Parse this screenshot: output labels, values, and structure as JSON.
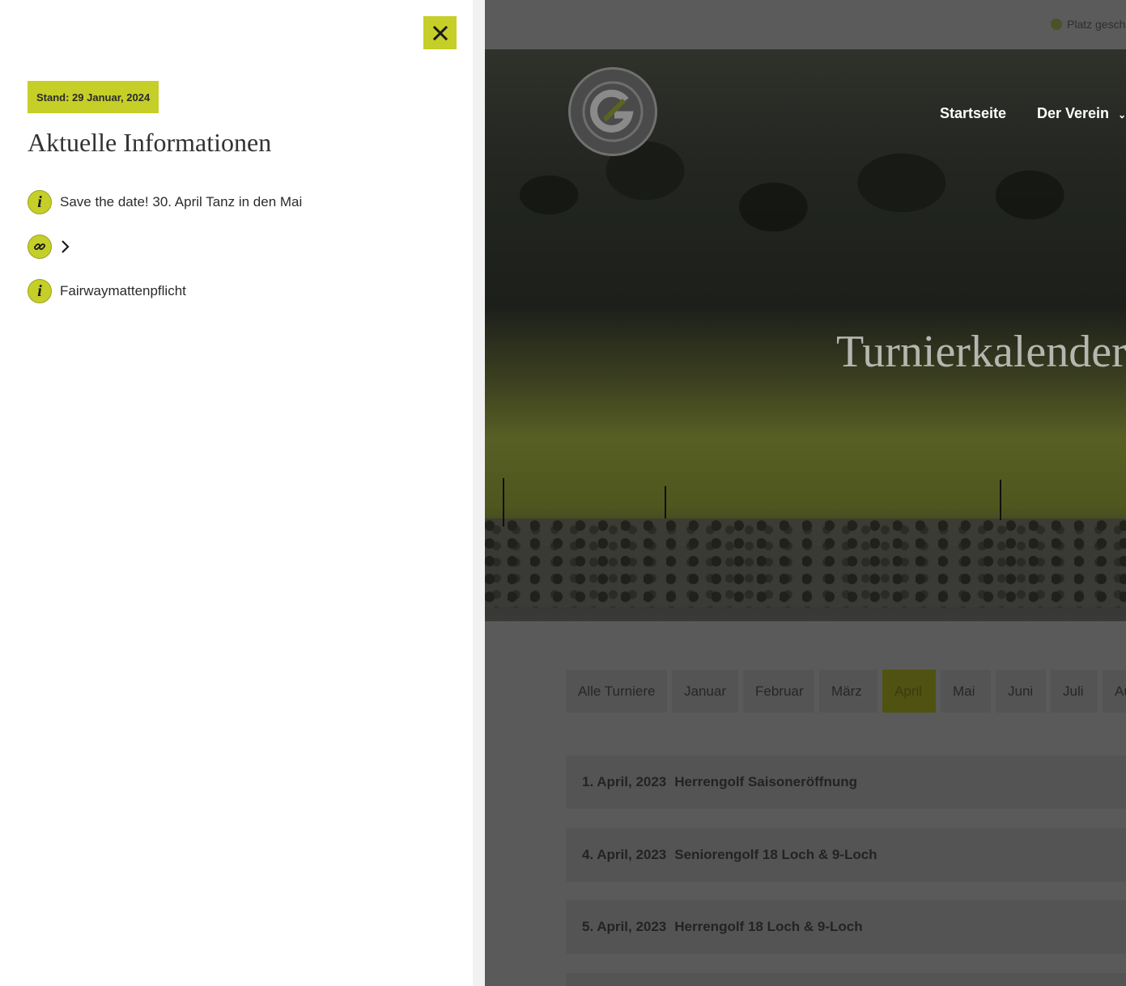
{
  "status": {
    "text": "Platz gesch"
  },
  "nav": {
    "items": [
      {
        "label": "Startseite"
      },
      {
        "label": "Der Verein"
      }
    ]
  },
  "hero": {
    "title": "Turnierkalender"
  },
  "months": {
    "items": [
      "Alle Turniere",
      "Januar",
      "Februar",
      "März",
      "April",
      "Mai",
      "Juni",
      "Juli",
      "Aug"
    ],
    "active": "April"
  },
  "events": [
    {
      "date": "1. April, 2023",
      "name": "Herrengolf Saisoneröffnung"
    },
    {
      "date": "4. April, 2023",
      "name": "Seniorengolf 18 Loch & 9-Loch"
    },
    {
      "date": "5. April, 2023",
      "name": "Herrengolf 18 Loch & 9-Loch"
    }
  ],
  "panel": {
    "stand": "Stand: 29 Januar, 2024",
    "title": "Aktuelle Informationen",
    "items": [
      {
        "icon": "info-icon",
        "text": "Save the date! 30. April Tanz in den Mai"
      },
      {
        "icon": "link-icon",
        "text": ""
      },
      {
        "icon": "info-icon",
        "text": "Fairwaymattenpflicht"
      }
    ]
  },
  "colors": {
    "accent": "#c5cf28",
    "overlay": "#5a5a5a",
    "panel_bg": "#ffffff"
  }
}
